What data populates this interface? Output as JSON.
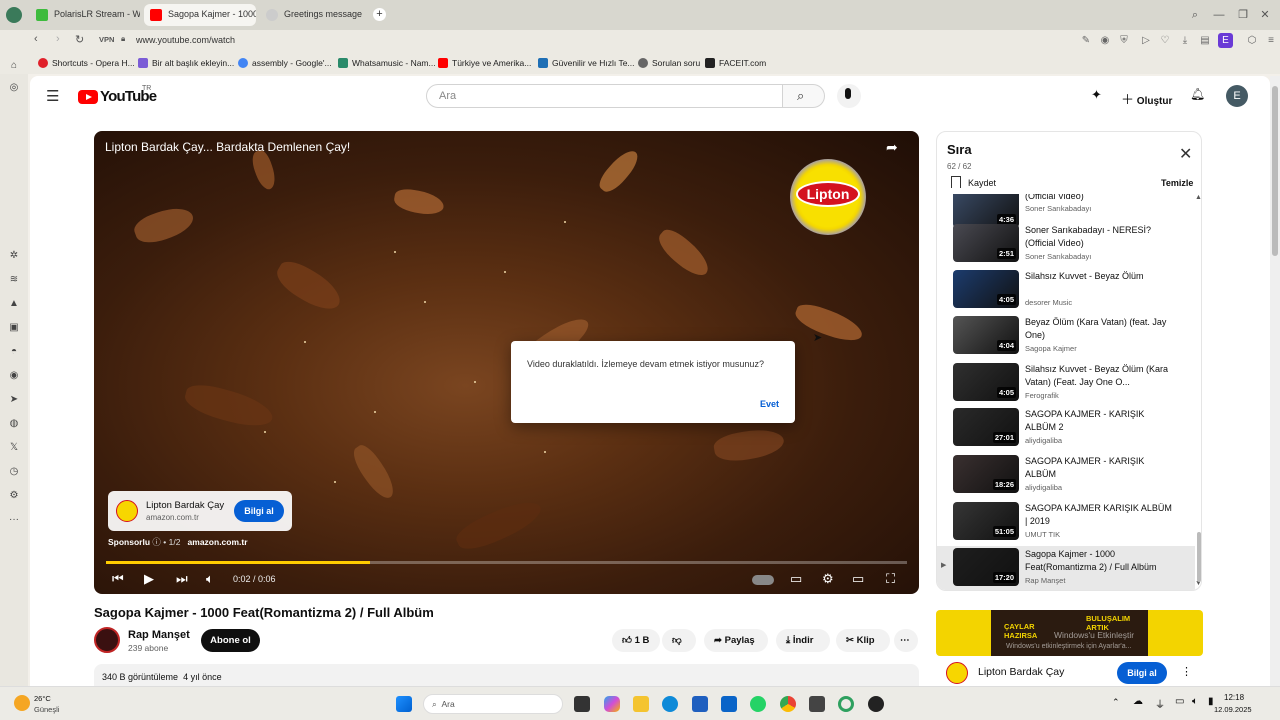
{
  "browser": {
    "tabs": [
      {
        "label": "PolarisLR Stream - Watch",
        "color": "#3dbb3d"
      },
      {
        "label": "Sagopa Kajmer - 1000 F...",
        "color": "#ff0000"
      },
      {
        "label": "Greetings message",
        "color": "#cccccc"
      }
    ],
    "new_tab": "+",
    "vpn": "VPN",
    "url": "www.youtube.com/watch",
    "profile_initial": "E",
    "bookmarks": [
      {
        "label": "Shortcuts - Opera H...",
        "color": "#e0202a"
      },
      {
        "label": "Bir alt başlık ekleyin...",
        "color": "#7b5cd6"
      },
      {
        "label": "assembly - Google'...",
        "color": "#4285f4"
      },
      {
        "label": "Whatsamusic - Nam...",
        "color": "#2a8a6a"
      },
      {
        "label": "Türkiye ve Amerika...",
        "color": "#ff0000"
      },
      {
        "label": "Güvenilir ve Hızlı Te...",
        "color": "#1f6fb5"
      },
      {
        "label": "Sorulan soru",
        "color": "#666666"
      },
      {
        "label": "FACEIT.com",
        "color": "#222222"
      }
    ]
  },
  "youtube": {
    "logo_text": "YouTube",
    "country": "TR",
    "search_placeholder": "Ara",
    "create_label": "Oluştur",
    "avatar_initial": "E",
    "player": {
      "overlay_title": "Lipton Bardak Çay... Bardakta Demlenen Çay!",
      "brand_logo": "Lipton",
      "ad_card_title": "Lipton Bardak Çay",
      "ad_card_domain": "amazon.com.tr",
      "ad_card_button": "Bilgi al",
      "ad_sponsored": "Sponsorlu",
      "ad_counter": "• 1/2",
      "ad_domain": "amazon.com.tr",
      "time": "0:02 / 0:06",
      "progress": 0.33
    },
    "dialog": {
      "message": "Video duraklatıldı. İzlemeye devam etmek istiyor musunuz?",
      "confirm": "Evet"
    },
    "video": {
      "title": "Sagopa Kajmer - 1000 Feat(Romantizma 2) / Full Albüm",
      "channel": "Rap Manşet",
      "subscribers": "239 abone",
      "subscribe": "Abone ol",
      "likes": "1 B",
      "share": "Paylaş",
      "download": "İndir",
      "clip": "Klip",
      "views": "340 B görüntüleme",
      "age": "4 yıl önce"
    },
    "queue": {
      "title": "Sıra",
      "count": "62 / 62",
      "save": "Kaydet",
      "clear": "Temizle",
      "items": [
        {
          "title": "(Official Video)",
          "channel": "Soner Sarıkabadayı",
          "duration": "4:36",
          "thumb": "#3a4b66"
        },
        {
          "title": "Soner Sarıkabadayı - NERESİ? (Official Video)",
          "channel": "Soner Sarıkabadayı",
          "duration": "2:51",
          "thumb": "#4a4a52"
        },
        {
          "title": "Silahsız Kuvvet - Beyaz Ölüm",
          "channel": "desorer Music",
          "duration": "4:05",
          "thumb": "#1c3c6e"
        },
        {
          "title": "Beyaz Ölüm (Kara Vatan) (feat. Jay One)",
          "channel": "Sagopa Kajmer",
          "duration": "4:04",
          "thumb": "#555555"
        },
        {
          "title": "Silahsız Kuvvet - Beyaz Ölüm (Kara Vatan) (Feat. Jay One O...",
          "channel": "Ferografik",
          "duration": "4:05",
          "thumb": "#303030"
        },
        {
          "title": "SAGOPA KAJMER - KARIŞIK ALBÜM 2",
          "channel": "aliydigaliba",
          "duration": "27:01",
          "thumb": "#2a2a2a"
        },
        {
          "title": "SAGOPA KAJMER - KARIŞIK ALBÜM",
          "channel": "aliydigaliba",
          "duration": "18:26",
          "thumb": "#3a3030"
        },
        {
          "title": "SAGOPA KAJMER KARIŞIK ALBÜM | 2019",
          "channel": "UMUT TIK",
          "duration": "51:05",
          "thumb": "#363636"
        },
        {
          "title": "Sagopa Kajmer - 1000 Feat(Romantizma 2) / Full Albüm",
          "channel": "Rap Manşet",
          "duration": "17:20",
          "thumb": "#1e1e1e",
          "current": true
        }
      ]
    },
    "promo": {
      "headline": "ÇAYLAR HAZIRSA",
      "headline2": "BULUŞALIM ARTIK",
      "watermark": "Windows'u Etkinleştir",
      "watermark2": "Windows'u etkinleştirmek için Ayarlar'a...",
      "advertiser": "Lipton Bardak Çay",
      "button": "Bilgi al"
    }
  },
  "taskbar": {
    "weather_temp": "26°C",
    "weather_desc": "Güneşli",
    "search_placeholder": "Ara",
    "time": "12:18",
    "date": "12.09.2025"
  }
}
